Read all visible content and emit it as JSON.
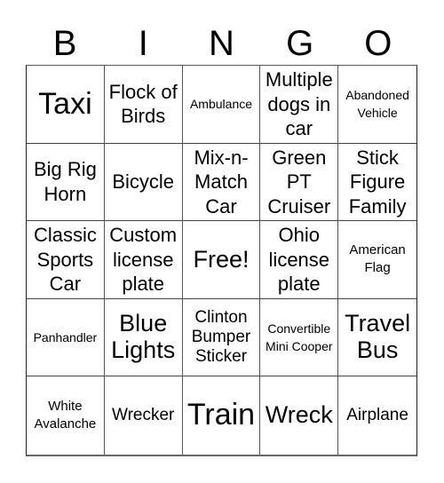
{
  "header": [
    "B",
    "I",
    "N",
    "G",
    "O"
  ],
  "cells": [
    [
      "Taxi",
      "Flock of Birds",
      "Ambulance",
      "Multiple dogs in car",
      "Abandoned Vehicle"
    ],
    [
      "Big Rig Horn",
      "Bicycle",
      "Mix-n-Match Car",
      "Green PT Cruiser",
      "Stick Figure Family"
    ],
    [
      "Classic Sports Car",
      "Custom license plate",
      "Free!",
      "Ohio license plate",
      "American Flag"
    ],
    [
      "Panhandler",
      "Blue Lights",
      "Clinton Bumper Sticker",
      "Convertible Mini Cooper",
      "Travel Bus"
    ],
    [
      "White Avalanche",
      "Wrecker",
      "Train",
      "Wreck",
      "Airplane"
    ]
  ]
}
